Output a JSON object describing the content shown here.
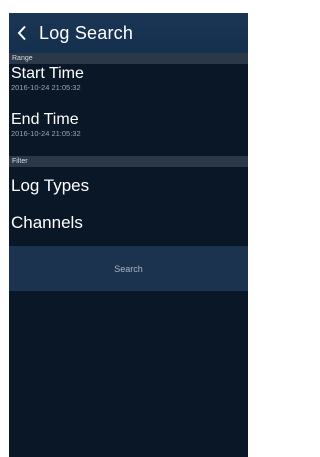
{
  "header": {
    "title": "Log Search"
  },
  "range": {
    "section_label": "Range",
    "start": {
      "label": "Start Time",
      "value": "2016-10-24 21:05:32"
    },
    "end": {
      "label": "End Time",
      "value": "2016-10-24 21:05:32"
    }
  },
  "filter": {
    "section_label": "Filter",
    "log_types": "Log Types",
    "channels": "Channels"
  },
  "search_button": "Search"
}
